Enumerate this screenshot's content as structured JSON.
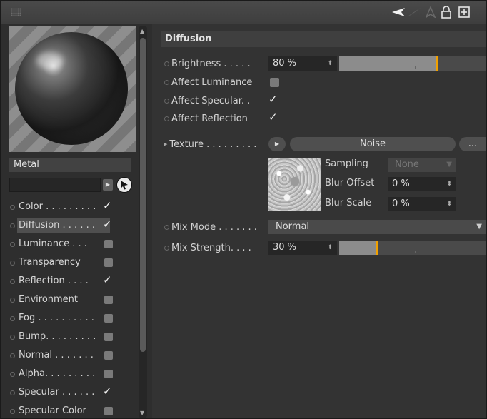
{
  "toolbar": {
    "icons": [
      "grip-icon",
      "back-arrow-icon",
      "forward-arrow-icon",
      "up-arrow-icon",
      "lock-icon",
      "new-window-icon"
    ]
  },
  "material": {
    "name": "Metal"
  },
  "channels": [
    {
      "label": "Color . . . . . . . . .",
      "checked": true
    },
    {
      "label": "Diffusion . . . . . .",
      "checked": true,
      "selected": true
    },
    {
      "label": "Luminance . . .",
      "checked": false
    },
    {
      "label": "Transparency",
      "checked": false
    },
    {
      "label": "Reflection . . . .",
      "checked": true
    },
    {
      "label": "Environment",
      "checked": false
    },
    {
      "label": "Fog . . . . . . . . . .",
      "checked": false
    },
    {
      "label": "Bump. . . . . . . . .",
      "checked": false
    },
    {
      "label": "Normal . . . . . . .",
      "checked": false
    },
    {
      "label": "Alpha. . . . . . . . .",
      "checked": false
    },
    {
      "label": "Specular . . . . . .",
      "checked": true
    },
    {
      "label": "Specular Color",
      "checked": false
    }
  ],
  "diffusion": {
    "section_title": "Diffusion",
    "brightness_label": "Brightness . . . . .",
    "brightness_value": "80 %",
    "brightness_fraction": 0.8,
    "affect_luminance_label": "Affect Luminance",
    "affect_luminance": false,
    "affect_specular_label": "Affect Specular. .",
    "affect_specular": true,
    "affect_reflection_label": "Affect Reflection",
    "affect_reflection": true,
    "texture_label": "Texture . . . . . . . . .",
    "texture_name": "Noise",
    "texture_more": "...",
    "sampling_label": "Sampling",
    "sampling_value": "None",
    "blur_offset_label": "Blur Offset",
    "blur_offset_value": "0 %",
    "blur_scale_label": "Blur Scale",
    "blur_scale_value": "0 %",
    "mix_mode_label": "Mix Mode . . . . . . .",
    "mix_mode_value": "Normal",
    "mix_strength_label": "Mix Strength. . . .",
    "mix_strength_value": "30 %",
    "mix_strength_fraction": 0.3
  },
  "colors": {
    "slider_mark": "#f0a000",
    "panel_bg": "#333333"
  }
}
